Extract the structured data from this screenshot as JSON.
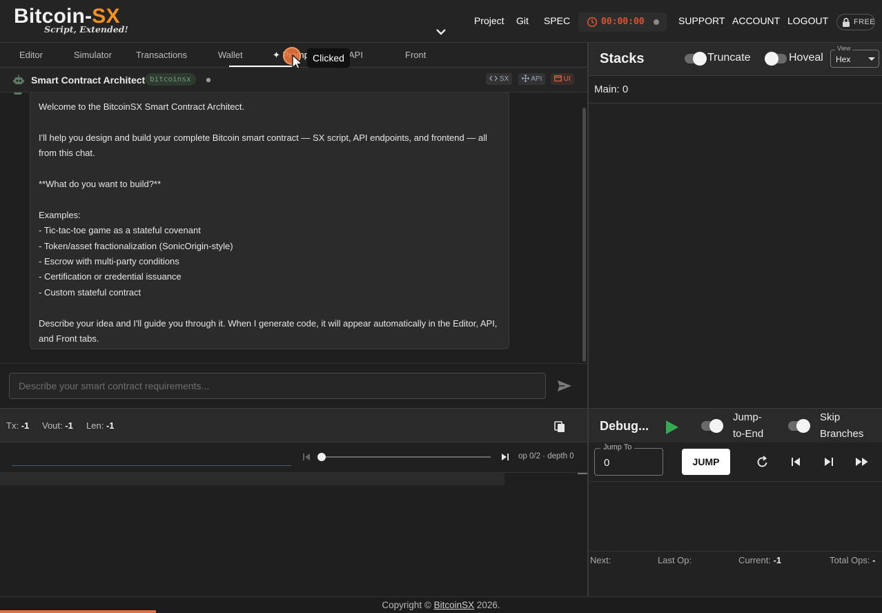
{
  "header": {
    "logo_main": "Bitcoin-",
    "logo_accent": "SX",
    "logo_sub": "Script, Extended!",
    "nav": [
      "Project",
      "Git",
      "SPEC"
    ],
    "timer": "00:00:00",
    "right_nav": [
      "SUPPORT",
      "ACCOUNT",
      "LOGOUT"
    ],
    "plan_badge": "FREE"
  },
  "tabs": [
    "Editor",
    "Simulator",
    "Transactions",
    "Wallet",
    "✦ Promp",
    "API",
    "Front"
  ],
  "tooltip": "Clicked",
  "architect": {
    "title": "Smart Contract Architect",
    "model": "bitcoinsx",
    "chips": [
      "SX",
      "API",
      "UI"
    ],
    "message": "Welcome to the BitcoinSX Smart Contract Architect.\n\nI'll help you design and build your complete Bitcoin smart contract — SX script, API endpoints, and frontend — all from this chat.\n\n**What do you want to build?**\n\nExamples:\n- Tic-tac-toe game as a stateful covenant\n- Token/asset fractionalization (SonicOrigin-style)\n- Escrow with multi-party conditions\n- Certification or credential issuance\n- Custom stateful contract\n\nDescribe your idea and I'll guide you through it. When I generate code, it will appear automatically in the Editor, API, and Front tabs.",
    "input_placeholder": "Describe your smart contract requirements..."
  },
  "txbar": {
    "tx_label": "Tx:",
    "tx_value": "-1",
    "vout_label": "Vout:",
    "vout_value": "-1",
    "len_label": "Len:",
    "len_value": "-1"
  },
  "scrubber": {
    "status": "op 0/2 · depth 0"
  },
  "stacks": {
    "title": "Stacks",
    "truncate_label": "Truncate",
    "hoveal_label": "Hoveal",
    "view_label": "View",
    "view_value": "Hex",
    "main_label": "Main: 0"
  },
  "debugger": {
    "title": "Debug...",
    "jump_to_end_label": "Jump-\nto-End",
    "skip_branches_label": "Skip\nBranches",
    "jump_to_label": "Jump To",
    "jump_to_value": "0",
    "jump_button": "JUMP",
    "next_label": "Next:",
    "last_op_label": "Last Op:",
    "current_label": "Current:",
    "current_value": "-1",
    "total_ops_label": "Total Ops:",
    "total_ops_value": "-"
  },
  "footer": {
    "prefix": "Copyright © ",
    "link": "BitcoinSX",
    "suffix": " 2026."
  },
  "colors": {
    "accent_orange": "#f7931a",
    "timer_red": "#e0522f",
    "play_green": "#35a853",
    "progress_orange": "#e36f45"
  }
}
